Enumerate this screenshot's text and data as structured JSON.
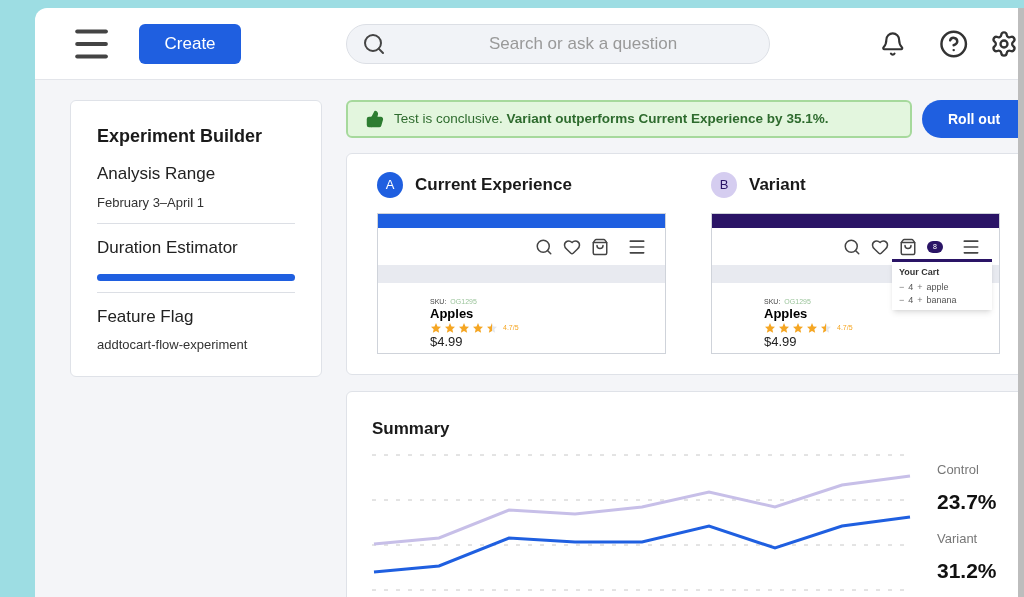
{
  "header": {
    "create_button": "Create",
    "search": {
      "placeholder": "Search or ask a question"
    }
  },
  "builder": {
    "title": "Experiment Builder",
    "sections": [
      {
        "kind": "text",
        "label": "Analysis Range",
        "value": "February 3–April 1"
      },
      {
        "kind": "bar",
        "label": "Duration Estimator",
        "level": 1
      },
      {
        "kind": "text",
        "label": "Feature Flag",
        "value": "addtocart-flow-experiment"
      }
    ]
  },
  "banner": {
    "text": "Test is conclusive. **Variant outperforms Current Experience by 35.1%.**",
    "button": "Roll out"
  },
  "variants": [
    {
      "badge": "A",
      "title": "Current Experience",
      "color": "#1f5fe0",
      "cart_open": false,
      "sku_label": "SKU:",
      "sku": "OG1295",
      "product": "Apples",
      "stars": 4.5,
      "rating": "4.7/5",
      "price": "$4.99"
    },
    {
      "badge": "B",
      "title": "Variant",
      "color": "#2a1466",
      "cart_count": "8",
      "cart_open": true,
      "cart_title": "Your Cart",
      "cart_items": [
        {
          "minus": "−",
          "qty": "4",
          "plus": "+",
          "name": "apple"
        },
        {
          "minus": "−",
          "qty": "4",
          "plus": "+",
          "name": "banana"
        }
      ],
      "sku_label": "SKU:",
      "sku": "OG1295",
      "product": "Apples",
      "stars": 4.5,
      "rating": "4.7/5",
      "price": "$4.99"
    }
  ],
  "summary": {
    "title": "Summary",
    "legend": [
      {
        "label": "Control",
        "value": "23.7%"
      },
      {
        "label": "Variant",
        "value": "31.2%"
      }
    ]
  }
}
